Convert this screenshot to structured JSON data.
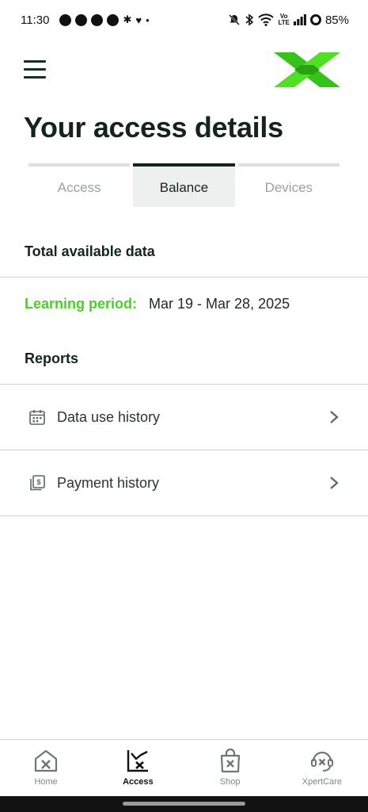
{
  "status_bar": {
    "time": "11:30",
    "network_label": "Vo\nLTE",
    "battery": "85%",
    "notification_icons": [
      "facebook-icon",
      "facebook-icon",
      "facebook-icon",
      "messenger-icon",
      "slack-icon",
      "heart-icon",
      "dot-icon"
    ],
    "system_icons": [
      "mute-icon",
      "bluetooth-icon",
      "wifi-icon",
      "volte-icon",
      "signal-icon",
      "battery-icon"
    ]
  },
  "header": {
    "menu_icon": "hamburger-menu-icon",
    "logo": "x-logo",
    "brand_color": "#3fd11c"
  },
  "page": {
    "title": "Your access details"
  },
  "tabs": [
    {
      "label": "Access",
      "active": false
    },
    {
      "label": "Balance",
      "active": true
    },
    {
      "label": "Devices",
      "active": false
    }
  ],
  "balance": {
    "total_available_title": "Total available data",
    "learning_period_label": "Learning period:",
    "learning_period_value": "Mar 19 - Mar 28, 2025"
  },
  "reports": {
    "title": "Reports",
    "items": [
      {
        "label": "Data use history",
        "icon": "calendar-icon"
      },
      {
        "label": "Payment history",
        "icon": "receipt-icon"
      }
    ]
  },
  "bottom_nav": [
    {
      "label": "Home",
      "icon": "home-icon",
      "active": false
    },
    {
      "label": "Access",
      "icon": "access-chart-icon",
      "active": true
    },
    {
      "label": "Shop",
      "icon": "shop-bag-icon",
      "active": false
    },
    {
      "label": "XpertCare",
      "icon": "headset-icon",
      "active": false
    }
  ],
  "colors": {
    "accent_green": "#4ccf2b",
    "text_dark": "#14231f",
    "tab_active_bg": "#eef0ef"
  }
}
